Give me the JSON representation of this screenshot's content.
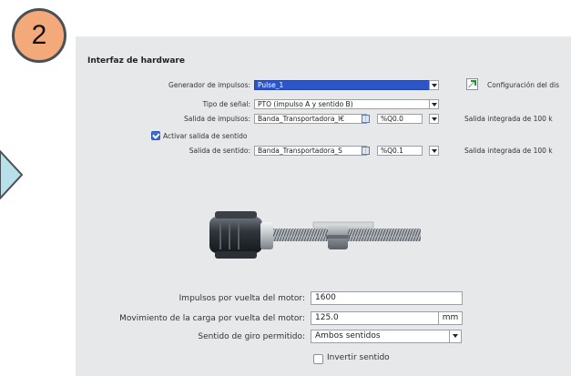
{
  "step_badge": "2",
  "section_title": "Interfaz de hardware",
  "hardware": {
    "pulse_generator": {
      "label": "Generador de impulsos:",
      "value": "Pulse_1"
    },
    "config_link": "Configuración del dis",
    "signal_type": {
      "label": "Tipo de señal:",
      "value": "PTO (impulso A y sentido B)"
    },
    "pulse_output": {
      "label": "Salida de impulsos:",
      "tag": "Banda_Transportadora_I€",
      "address": "%Q0.0",
      "note": "Salida integrada de 100 k"
    },
    "direction_enable": {
      "label": "Activar salida de sentido",
      "checked": true
    },
    "direction_output": {
      "label": "Salida de sentido:",
      "tag": "Banda_Transportadora_S",
      "address": "%Q0.1",
      "note": "Salida integrada de 100 k"
    }
  },
  "mechanics": {
    "pulses_per_rev": {
      "label": "Impulsos por vuelta del motor:",
      "value": "1600"
    },
    "load_per_rev": {
      "label": "Movimiento de la carga por vuelta del motor:",
      "value": "125.0",
      "unit": "mm"
    },
    "rotation": {
      "label": "Sentido de giro permitido:",
      "value": "Ambos sentidos"
    },
    "invert": {
      "label": "Invertir sentido",
      "checked": false
    }
  },
  "icons": [
    "arrow-right-icon",
    "wizard-icon",
    "browse-icon",
    "checkbox-icon",
    "motor-illustration"
  ]
}
